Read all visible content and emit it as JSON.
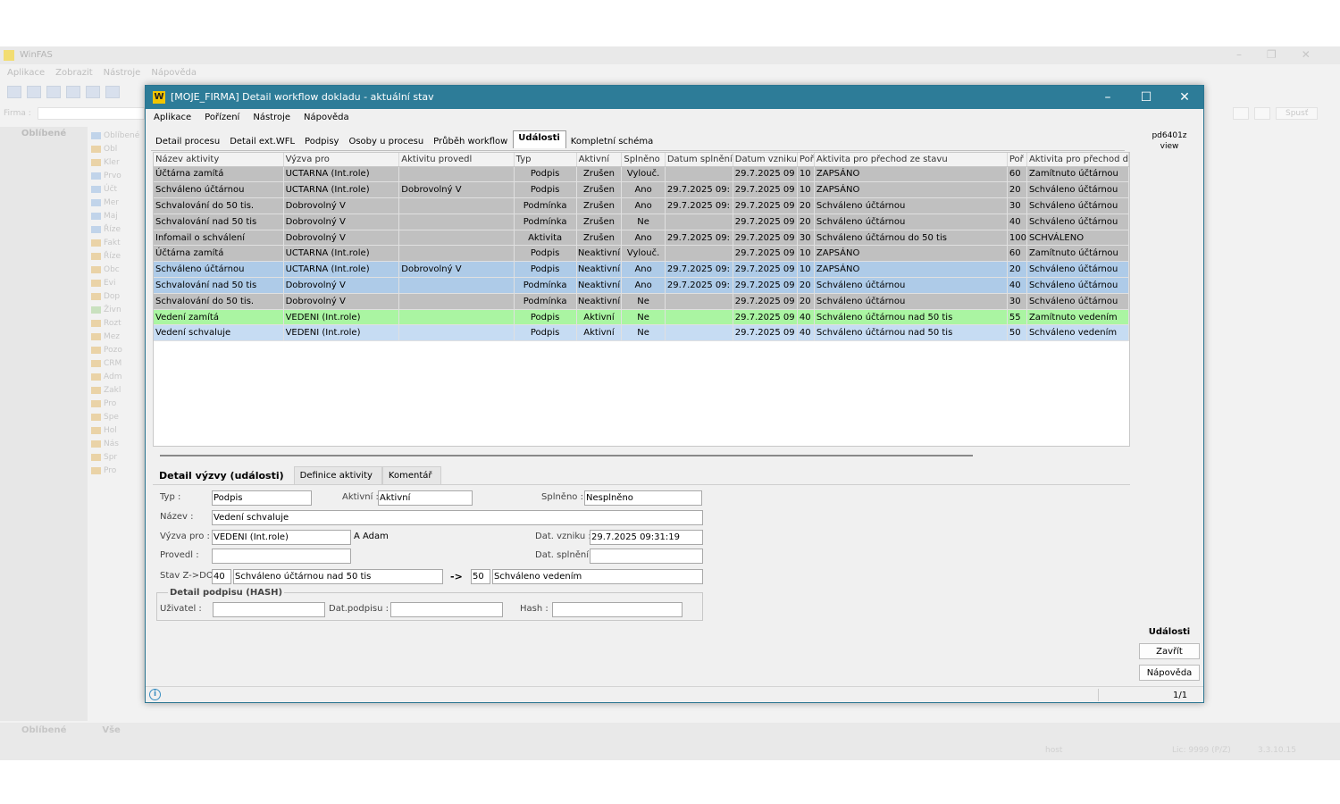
{
  "background_app": {
    "title": "WinFAS",
    "menu": [
      "Aplikace",
      "Zobrazit",
      "Nástroje",
      "Nápověda"
    ],
    "firma_label": "Firma :",
    "spust_label": "Spusť",
    "left_tab": "Oblíbené",
    "tree": [
      "Oblíbené",
      "Obl",
      "Kler",
      "Prvo",
      "Účt",
      "Mer",
      "Maj",
      "Říze",
      "Fakt",
      "Říze",
      "Obc",
      "Evi",
      "Dop",
      "Živn",
      "Rozt",
      "Mez",
      "Pozo",
      "CRM",
      "Adm",
      "Zakl",
      "Pro",
      "Spe",
      "Hol",
      "Nás",
      "Spr",
      "Pro"
    ],
    "bottom_tabs": [
      "Oblíbené",
      "Vše"
    ],
    "status_host": "host",
    "status_lic": "Lic: 9999 (P/Z)",
    "status_ver": "3.3.10.15"
  },
  "dialog": {
    "title": "[MOJE_FIRMA] Detail workflow dokladu - aktuální stav",
    "logo": "W",
    "menu": [
      "Aplikace",
      "Pořízení",
      "Nástroje",
      "Nápověda"
    ],
    "tabs": [
      "Detail procesu",
      "Detail ext.WFL",
      "Podpisy",
      "Osoby u procesu",
      "Průběh workflow",
      "Události",
      "Kompletní schéma"
    ],
    "active_tab": 5
  },
  "grid": {
    "columns": [
      "Název aktivity",
      "Výzva pro",
      "Aktivitu provedl",
      "Typ",
      "Aktivní",
      "Splněno",
      "Datum splnění",
      "Datum vzniku",
      "Poř",
      "Aktivita pro přechod ze stavu",
      "Poř",
      "Aktivita pro přechod d"
    ],
    "rows": [
      {
        "style": "gray",
        "cells": [
          "Účtárna zamítá",
          "UCTARNA (Int.role)",
          "",
          "Podpis",
          "Zrušen",
          "Vylouč.",
          "",
          "29.7.2025 09",
          "10",
          "ZAPSÁNO",
          "60",
          "Zamítnuto účtárnou"
        ]
      },
      {
        "style": "gray",
        "cells": [
          "Schváleno účtárnou",
          "UCTARNA (Int.role)",
          "Dobrovolný V",
          "Podpis",
          "Zrušen",
          "Ano",
          "29.7.2025 09:",
          "29.7.2025 09",
          "10",
          "ZAPSÁNO",
          "20",
          "Schváleno účtárnou"
        ]
      },
      {
        "style": "gray",
        "cells": [
          "Schvalování do 50 tis.",
          "Dobrovolný V",
          "",
          "Podmínka",
          "Zrušen",
          "Ano",
          "29.7.2025 09:",
          "29.7.2025 09",
          "20",
          "Schváleno účtárnou",
          "30",
          "Schváleno účtárnou"
        ]
      },
      {
        "style": "gray",
        "cells": [
          "Schvalování nad 50 tis",
          "Dobrovolný V",
          "",
          "Podmínka",
          "Zrušen",
          "Ne",
          "",
          "29.7.2025 09",
          "20",
          "Schváleno účtárnou",
          "40",
          "Schváleno účtárnou"
        ]
      },
      {
        "style": "gray",
        "cells": [
          "Infomail o schválení",
          "Dobrovolný V",
          "",
          "Aktivita",
          "Zrušen",
          "Ano",
          "29.7.2025 09:",
          "29.7.2025 09",
          "30",
          "Schváleno účtárnou do 50 tis",
          "100",
          "SCHVÁLENO"
        ]
      },
      {
        "style": "gray",
        "cells": [
          "Účtárna zamítá",
          "UCTARNA (Int.role)",
          "",
          "Podpis",
          "Neaktivní",
          "Vylouč.",
          "",
          "29.7.2025 09",
          "10",
          "ZAPSÁNO",
          "60",
          "Zamítnuto účtárnou"
        ]
      },
      {
        "style": "blue",
        "cells": [
          "Schváleno účtárnou",
          "UCTARNA (Int.role)",
          "Dobrovolný V",
          "Podpis",
          "Neaktivní",
          "Ano",
          "29.7.2025 09:",
          "29.7.2025 09",
          "10",
          "ZAPSÁNO",
          "20",
          "Schváleno účtárnou"
        ]
      },
      {
        "style": "blue",
        "cells": [
          "Schvalování nad 50 tis",
          "Dobrovolný V",
          "",
          "Podmínka",
          "Neaktivní",
          "Ano",
          "29.7.2025 09:",
          "29.7.2025 09",
          "20",
          "Schváleno účtárnou",
          "40",
          "Schváleno účtárnou"
        ]
      },
      {
        "style": "gray",
        "cells": [
          "Schvalování do 50 tis.",
          "Dobrovolný V",
          "",
          "Podmínka",
          "Neaktivní",
          "Ne",
          "",
          "29.7.2025 09",
          "20",
          "Schváleno účtárnou",
          "30",
          "Schváleno účtárnou"
        ]
      },
      {
        "style": "green",
        "cells": [
          "Vedení zamítá",
          "VEDENI (Int.role)",
          "",
          "Podpis",
          "Aktivní",
          "Ne",
          "",
          "29.7.2025 09",
          "40",
          "Schváleno účtárnou nad 50 tis",
          "55",
          "Zamítnuto vedením"
        ]
      },
      {
        "style": "lblue",
        "cells": [
          "Vedení schvaluje",
          "VEDENI (Int.role)",
          "",
          "Podpis",
          "Aktivní",
          "Ne",
          "",
          "29.7.2025 09",
          "40",
          "Schváleno účtárnou nad 50 tis",
          "50",
          "Schváleno vedením"
        ]
      }
    ]
  },
  "detail": {
    "tabs": [
      "Detail výzvy (události)",
      "Definice aktivity",
      "Komentář"
    ],
    "typ_label": "Typ :",
    "typ_value": "Podpis",
    "aktivni_label": "Aktivní :",
    "aktivni_value": "Aktivní",
    "splneno_label": "Splněno :",
    "splneno_value": "Nesplněno",
    "nazev_label": "Název :",
    "nazev_value": "Vedení schvaluje",
    "vyzva_label": "Výzva pro :",
    "vyzva_value": "VEDENI (Int.role)",
    "vyzva_person": "A Adam",
    "dat_vzniku_label": "Dat. vzniku :",
    "dat_vzniku_value": "29.7.2025 09:31:19",
    "provedl_label": "Provedl :",
    "provedl_value": "",
    "dat_splneni_label": "Dat. splnění :",
    "dat_splneni_value": "",
    "stav_label": "Stav Z->DO:",
    "stav_from_num": "40",
    "stav_from_text": "Schváleno účtárnou nad 50 tis",
    "stav_arrow": "->",
    "stav_to_num": "50",
    "stav_to_text": "Schváleno vedením",
    "hash_group": "Detail podpisu (HASH)",
    "uzivatel_label": "Uživatel :",
    "uzivatel_value": "",
    "dat_podpisu_label": "Dat.podpisu :",
    "dat_podpisu_value": "",
    "hash_label": "Hash :",
    "hash_value": ""
  },
  "right_panel": {
    "code": "pd6401z",
    "mode": "view",
    "label": "Události",
    "close_button": "Zavřít",
    "help_button": "Nápověda"
  },
  "statusbar": {
    "info_icon": "i",
    "page": "1/1"
  },
  "colors": {
    "titlebar": "#2d7c98",
    "row_gray": "#c0c0c0",
    "row_blue": "#aecbe8",
    "row_green": "#aaf5a2",
    "row_light_blue": "#c6dcf3"
  }
}
